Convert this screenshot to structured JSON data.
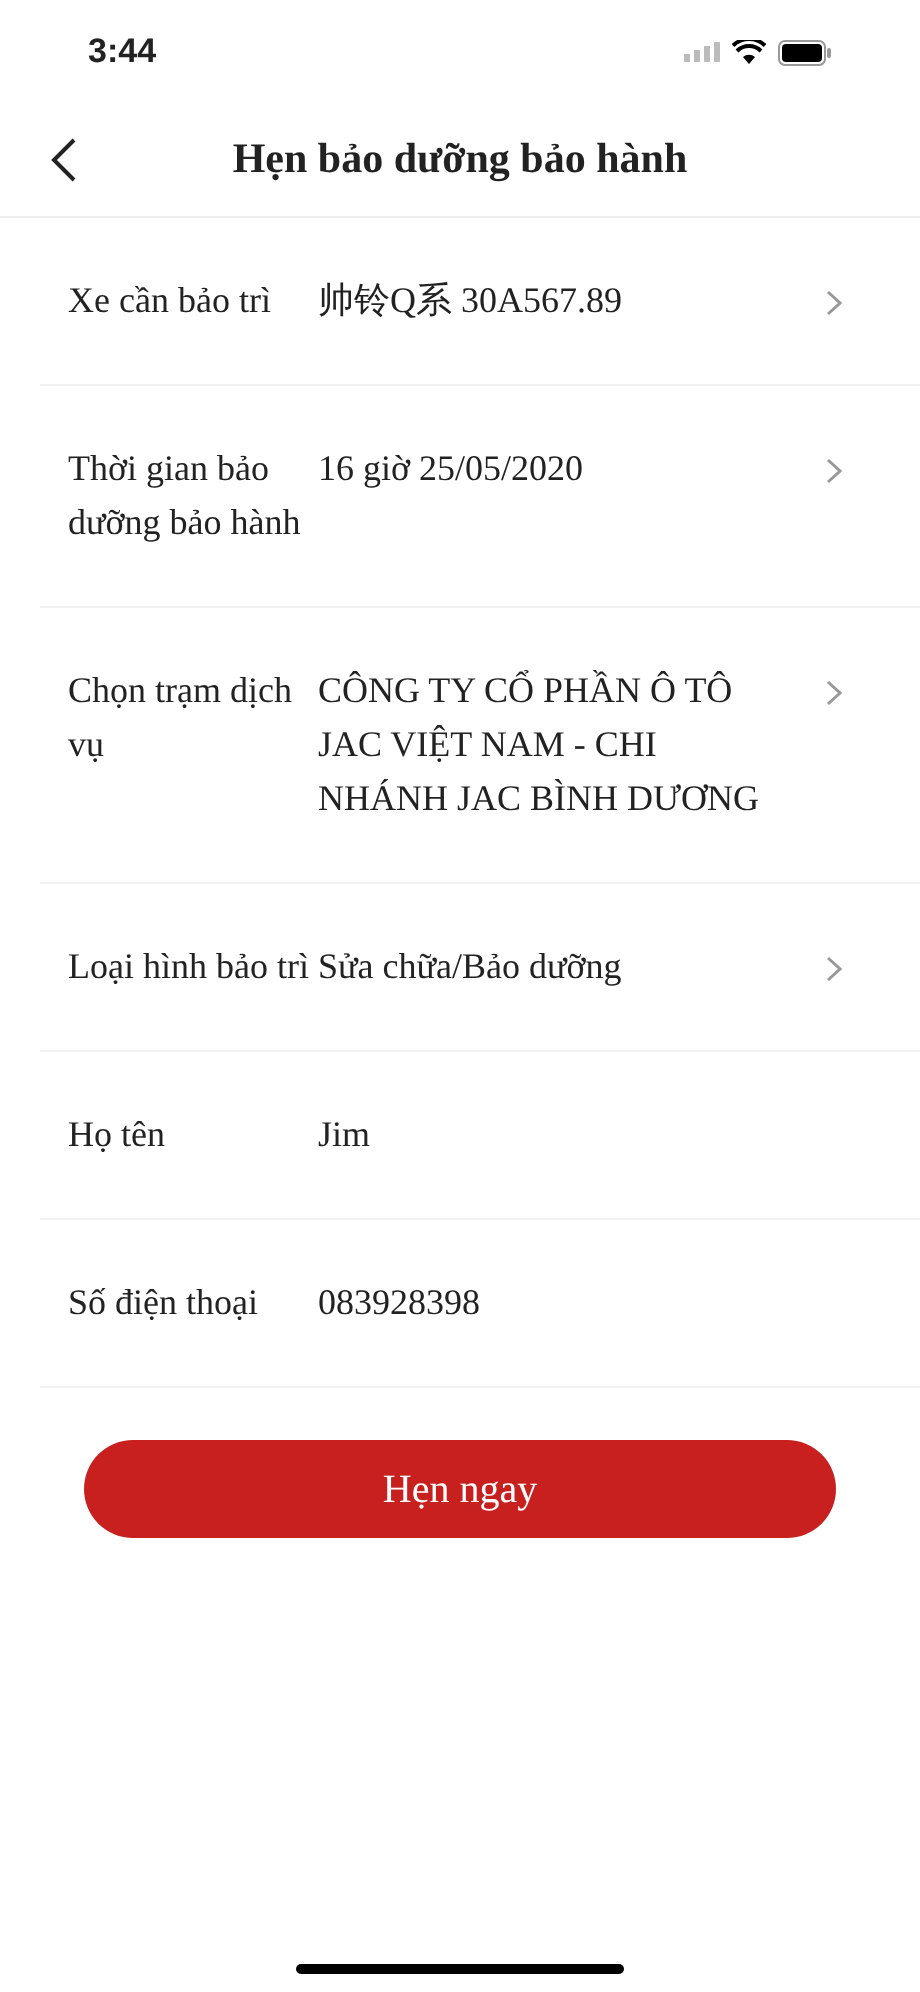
{
  "status_bar": {
    "time": "3:44"
  },
  "nav": {
    "title": "Hẹn bảo dưỡng bảo hành"
  },
  "rows": [
    {
      "kind": "select",
      "label": "Xe cần bảo trì",
      "value": "帅铃Q系 30A567.89"
    },
    {
      "kind": "select",
      "label": "Thời gian bảo dưỡng bảo hành",
      "value": "16 giờ 25/05/2020"
    },
    {
      "kind": "select",
      "label": "Chọn trạm dịch vụ",
      "value": "CÔNG TY CỔ PHẦN Ô TÔ JAC VIỆT NAM - CHI NHÁNH JAC BÌNH DƯƠNG"
    },
    {
      "kind": "select",
      "label": "Loại hình bảo trì",
      "value": "Sửa chữa/Bảo dưỡng"
    },
    {
      "kind": "text",
      "label": "Họ tên",
      "value": "Jim"
    },
    {
      "kind": "text",
      "label": "Số điện thoại",
      "value": "083928398"
    }
  ],
  "submit_button": "Hẹn ngay"
}
